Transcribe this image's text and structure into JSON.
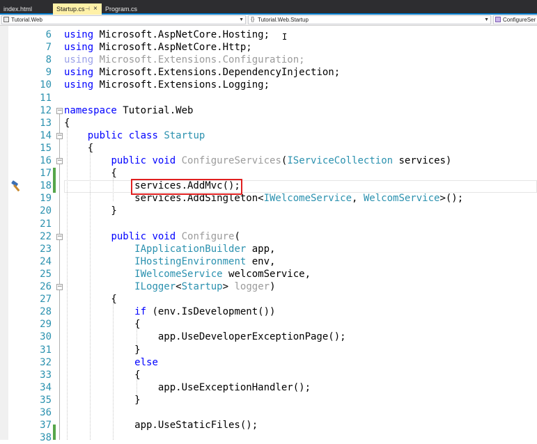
{
  "tabs": [
    {
      "label": "index.html"
    },
    {
      "label": "Startup.cs",
      "pin": "⊣",
      "close": "×"
    },
    {
      "label": "Program.cs"
    }
  ],
  "nav": {
    "project": "Tutorial.Web",
    "type": "Tutorial.Web.Startup",
    "member": "ConfigureSer"
  },
  "code_lines": [
    {
      "num": "6",
      "tokens": [
        {
          "t": "using",
          "c": "kw"
        },
        {
          "t": " Microsoft.AspNetCore.Hosting;",
          "c": ""
        }
      ]
    },
    {
      "num": "7",
      "tokens": [
        {
          "t": "using",
          "c": "kw"
        },
        {
          "t": " Microsoft.AspNetCore.Http;",
          "c": ""
        }
      ]
    },
    {
      "num": "8",
      "tokens": [
        {
          "t": "using",
          "c": "fadeblue"
        },
        {
          "t": " Microsoft.Extensions.Configuration;",
          "c": "fade"
        }
      ]
    },
    {
      "num": "9",
      "tokens": [
        {
          "t": "using",
          "c": "kw"
        },
        {
          "t": " Microsoft.Extensions.DependencyInjection;",
          "c": ""
        }
      ]
    },
    {
      "num": "10",
      "tokens": [
        {
          "t": "using",
          "c": "kw"
        },
        {
          "t": " Microsoft.Extensions.Logging;",
          "c": ""
        }
      ]
    },
    {
      "num": "11",
      "tokens": []
    },
    {
      "num": "12",
      "tokens": [
        {
          "t": "namespace",
          "c": "kw"
        },
        {
          "t": " Tutorial.Web",
          "c": ""
        }
      ]
    },
    {
      "num": "13",
      "tokens": [
        {
          "t": "{",
          "c": ""
        }
      ]
    },
    {
      "num": "14",
      "tokens": [
        {
          "t": "    ",
          "c": ""
        },
        {
          "t": "public",
          "c": "kw"
        },
        {
          "t": " ",
          "c": ""
        },
        {
          "t": "class",
          "c": "kw"
        },
        {
          "t": " ",
          "c": ""
        },
        {
          "t": "Startup",
          "c": "ty"
        }
      ]
    },
    {
      "num": "15",
      "tokens": [
        {
          "t": "    {",
          "c": ""
        }
      ]
    },
    {
      "num": "16",
      "tokens": [
        {
          "t": "        ",
          "c": ""
        },
        {
          "t": "public",
          "c": "kw"
        },
        {
          "t": " ",
          "c": ""
        },
        {
          "t": "void",
          "c": "kw"
        },
        {
          "t": " ",
          "c": ""
        },
        {
          "t": "ConfigureServices",
          "c": "fade"
        },
        {
          "t": "(",
          "c": ""
        },
        {
          "t": "IServiceCollection",
          "c": "ty"
        },
        {
          "t": " services)",
          "c": ""
        }
      ]
    },
    {
      "num": "17",
      "tokens": [
        {
          "t": "        {",
          "c": ""
        }
      ]
    },
    {
      "num": "18",
      "tokens": [
        {
          "t": "            services.AddMvc();",
          "c": ""
        }
      ]
    },
    {
      "num": "19",
      "tokens": [
        {
          "t": "            services.AddSingleton<",
          "c": ""
        },
        {
          "t": "IWelcomeService",
          "c": "ty"
        },
        {
          "t": ", ",
          "c": ""
        },
        {
          "t": "WelcomService",
          "c": "ty"
        },
        {
          "t": ">();",
          "c": ""
        }
      ]
    },
    {
      "num": "20",
      "tokens": [
        {
          "t": "        }",
          "c": ""
        }
      ]
    },
    {
      "num": "21",
      "tokens": []
    },
    {
      "num": "22",
      "tokens": [
        {
          "t": "        ",
          "c": ""
        },
        {
          "t": "public",
          "c": "kw"
        },
        {
          "t": " ",
          "c": ""
        },
        {
          "t": "void",
          "c": "kw"
        },
        {
          "t": " ",
          "c": ""
        },
        {
          "t": "Configure",
          "c": "fade"
        },
        {
          "t": "(",
          "c": ""
        }
      ]
    },
    {
      "num": "23",
      "tokens": [
        {
          "t": "            ",
          "c": ""
        },
        {
          "t": "IApplicationBuilder",
          "c": "ty"
        },
        {
          "t": " app,",
          "c": ""
        }
      ]
    },
    {
      "num": "24",
      "tokens": [
        {
          "t": "            ",
          "c": ""
        },
        {
          "t": "IHostingEnvironment",
          "c": "ty"
        },
        {
          "t": " env,",
          "c": ""
        }
      ]
    },
    {
      "num": "25",
      "tokens": [
        {
          "t": "            ",
          "c": ""
        },
        {
          "t": "IWelcomeService",
          "c": "ty"
        },
        {
          "t": " welcomService,",
          "c": ""
        }
      ]
    },
    {
      "num": "26",
      "tokens": [
        {
          "t": "            ",
          "c": ""
        },
        {
          "t": "ILogger",
          "c": "ty"
        },
        {
          "t": "<",
          "c": ""
        },
        {
          "t": "Startup",
          "c": "ty"
        },
        {
          "t": "> ",
          "c": ""
        },
        {
          "t": "logger",
          "c": "fade"
        },
        {
          "t": ")",
          "c": ""
        }
      ]
    },
    {
      "num": "27",
      "tokens": [
        {
          "t": "        {",
          "c": ""
        }
      ]
    },
    {
      "num": "28",
      "tokens": [
        {
          "t": "            ",
          "c": ""
        },
        {
          "t": "if",
          "c": "kw"
        },
        {
          "t": " (env.IsDevelopment())",
          "c": ""
        }
      ]
    },
    {
      "num": "29",
      "tokens": [
        {
          "t": "            {",
          "c": ""
        }
      ]
    },
    {
      "num": "30",
      "tokens": [
        {
          "t": "                app.UseDeveloperExceptionPage();",
          "c": ""
        }
      ]
    },
    {
      "num": "31",
      "tokens": [
        {
          "t": "            }",
          "c": ""
        }
      ]
    },
    {
      "num": "32",
      "tokens": [
        {
          "t": "            ",
          "c": ""
        },
        {
          "t": "else",
          "c": "kw"
        }
      ]
    },
    {
      "num": "33",
      "tokens": [
        {
          "t": "            {",
          "c": ""
        }
      ]
    },
    {
      "num": "34",
      "tokens": [
        {
          "t": "                app.UseExceptionHandler();",
          "c": ""
        }
      ]
    },
    {
      "num": "35",
      "tokens": [
        {
          "t": "            }",
          "c": ""
        }
      ]
    },
    {
      "num": "36",
      "tokens": []
    },
    {
      "num": "37",
      "tokens": [
        {
          "t": "            app.UseStaticFiles();",
          "c": ""
        }
      ]
    },
    {
      "num": "38",
      "tokens": []
    }
  ],
  "colors": {
    "keyword": "#0000ff",
    "type": "#2b91af",
    "line_number": "#2b91af",
    "change_bar": "#57a64a",
    "highlight_box": "#e02020",
    "tab_active": "#fff1a8"
  },
  "icons": {
    "breakpoint_glyph": "hammer-icon",
    "text_cursor": "i-beam-cursor-icon"
  }
}
